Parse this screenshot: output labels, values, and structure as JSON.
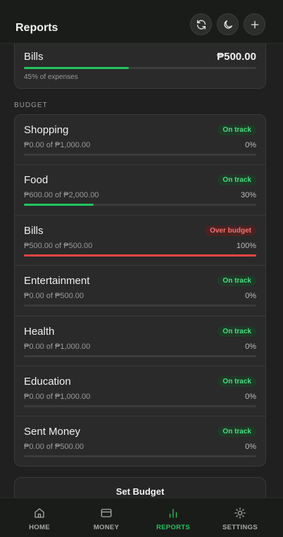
{
  "header": {
    "title": "Reports"
  },
  "top_card": {
    "name": "Bills",
    "amount": "₱500.00",
    "progress": 0.45,
    "subtitle": "45% of expenses"
  },
  "budget": {
    "section_label": "BUDGET",
    "items": [
      {
        "category": "Shopping",
        "status": "On track",
        "amounts": "₱0.00 of ₱1,000.00",
        "percent": "0%",
        "progress": 0.0
      },
      {
        "category": "Food",
        "status": "On track",
        "amounts": "₱600.00 of ₱2,000.00",
        "percent": "30%",
        "progress": 0.3
      },
      {
        "category": "Bills",
        "status": "Over budget",
        "amounts": "₱500.00 of ₱500.00",
        "percent": "100%",
        "progress": 1.0
      },
      {
        "category": "Entertainment",
        "status": "On track",
        "amounts": "₱0.00 of ₱500.00",
        "percent": "0%",
        "progress": 0.0
      },
      {
        "category": "Health",
        "status": "On track",
        "amounts": "₱0.00 of ₱1,000.00",
        "percent": "0%",
        "progress": 0.0
      },
      {
        "category": "Education",
        "status": "On track",
        "amounts": "₱0.00 of ₱1,000.00",
        "percent": "0%",
        "progress": 0.0
      },
      {
        "category": "Sent Money",
        "status": "On track",
        "amounts": "₱0.00 of ₱500.00",
        "percent": "0%",
        "progress": 0.0
      }
    ],
    "set_button_label": "Set Budget"
  },
  "nav": {
    "items": [
      {
        "label": "HOME",
        "icon": "home-icon"
      },
      {
        "label": "MONEY",
        "icon": "wallet-icon"
      },
      {
        "label": "REPORTS",
        "icon": "bar-chart-icon",
        "active": true
      },
      {
        "label": "SETTINGS",
        "icon": "gear-icon"
      }
    ]
  },
  "colors": {
    "accent": "#22c55e",
    "danger": "#ef4444",
    "background": "#202020",
    "card": "#2a2a2a"
  }
}
